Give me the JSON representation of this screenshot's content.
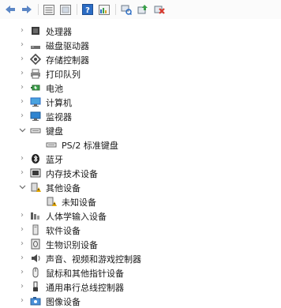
{
  "toolbar": {
    "buttons": [
      {
        "name": "back-icon"
      },
      {
        "name": "forward-icon"
      },
      {
        "name": "show-hidden-icon"
      },
      {
        "name": "properties-icon"
      },
      {
        "name": "help-icon"
      },
      {
        "name": "view-icon"
      },
      {
        "name": "scan-hardware-icon"
      },
      {
        "name": "update-driver-icon"
      },
      {
        "name": "uninstall-device-icon"
      }
    ]
  },
  "tree": {
    "items": [
      {
        "label": "处理器",
        "icon": "processor-icon",
        "expanded": false
      },
      {
        "label": "磁盘驱动器",
        "icon": "disk-drive-icon",
        "expanded": false
      },
      {
        "label": "存储控制器",
        "icon": "storage-controller-icon",
        "expanded": false
      },
      {
        "label": "打印队列",
        "icon": "printer-icon",
        "expanded": false
      },
      {
        "label": "电池",
        "icon": "battery-icon",
        "expanded": false
      },
      {
        "label": "计算机",
        "icon": "computer-icon",
        "expanded": false
      },
      {
        "label": "监视器",
        "icon": "monitor-icon",
        "expanded": false
      },
      {
        "label": "键盘",
        "icon": "keyboard-icon",
        "expanded": true
      },
      {
        "label": "PS/2 标准键盘",
        "icon": "keyboard-device-icon",
        "child": true
      },
      {
        "label": "蓝牙",
        "icon": "bluetooth-icon",
        "expanded": false
      },
      {
        "label": "内存技术设备",
        "icon": "memory-device-icon",
        "expanded": false
      },
      {
        "label": "其他设备",
        "icon": "other-devices-icon",
        "expanded": true
      },
      {
        "label": "未知设备",
        "icon": "unknown-device-icon",
        "child": true
      },
      {
        "label": "人体学输入设备",
        "icon": "hid-icon",
        "expanded": false
      },
      {
        "label": "软件设备",
        "icon": "software-device-icon",
        "expanded": false
      },
      {
        "label": "生物识别设备",
        "icon": "biometric-icon",
        "expanded": false
      },
      {
        "label": "声音、视频和游戏控制器",
        "icon": "sound-icon",
        "expanded": false
      },
      {
        "label": "鼠标和其他指针设备",
        "icon": "mouse-icon",
        "expanded": false
      },
      {
        "label": "通用串行总线控制器",
        "icon": "usb-icon",
        "expanded": false
      },
      {
        "label": "图像设备",
        "icon": "camera-icon",
        "expanded": false
      }
    ]
  },
  "colors": {
    "chevron": "#8a8a8a",
    "accent_blue": "#2b6cc4",
    "warning": "#e6a800",
    "red_x": "#d83a2e"
  }
}
